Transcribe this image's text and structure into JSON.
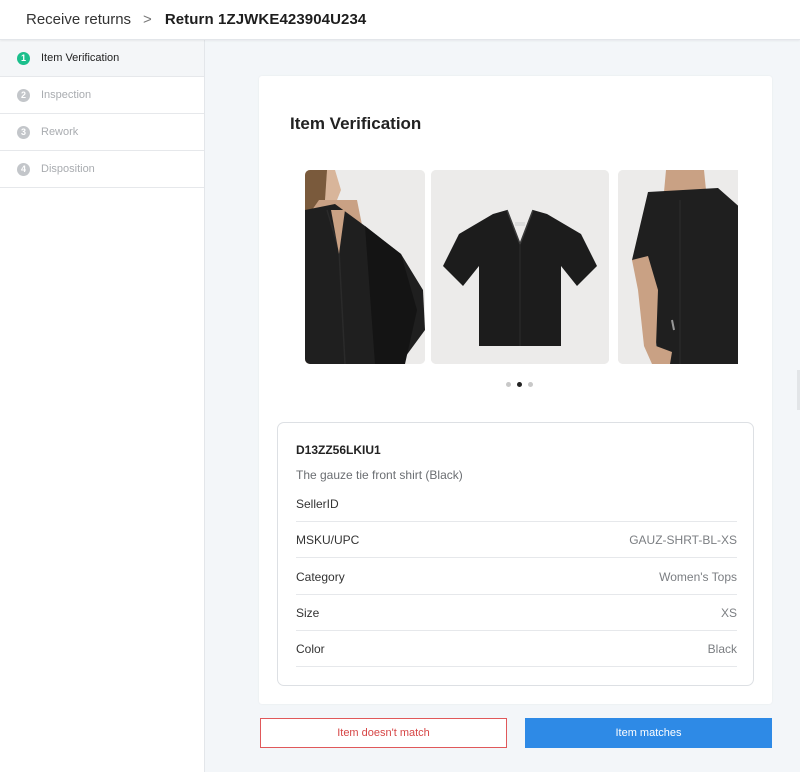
{
  "breadcrumb": {
    "root": "Receive returns",
    "separator": ">",
    "current": "Return 1ZJWKE423904U234"
  },
  "steps": [
    {
      "number": "1",
      "label": "Item Verification",
      "state": "active"
    },
    {
      "number": "2",
      "label": "Inspection",
      "state": "inactive"
    },
    {
      "number": "3",
      "label": "Rework",
      "state": "inactive"
    },
    {
      "number": "4",
      "label": "Disposition",
      "state": "inactive"
    }
  ],
  "verification": {
    "title": "Item Verification",
    "carousel": {
      "images": [
        "model-front-closeup-photo",
        "black-shirt-product-photo",
        "model-back-photo"
      ],
      "active_index": 1
    },
    "item": {
      "id": "D13ZZ56LKIU1",
      "description": "The gauze tie front shirt (Black)",
      "seller_label": "SellerID",
      "fields": [
        {
          "label": "MSKU/UPC",
          "value": "GAUZ-SHRT-BL-XS"
        },
        {
          "label": "Category",
          "value": "Women's Tops"
        },
        {
          "label": "Size",
          "value": "XS"
        },
        {
          "label": "Color",
          "value": "Black"
        }
      ]
    }
  },
  "actions": {
    "mismatch_label": "Item doesn't match",
    "match_label": "Item matches"
  },
  "colors": {
    "accent_green": "#1bbf8c",
    "primary_blue": "#2e8ae6",
    "danger_red": "#d64545"
  }
}
